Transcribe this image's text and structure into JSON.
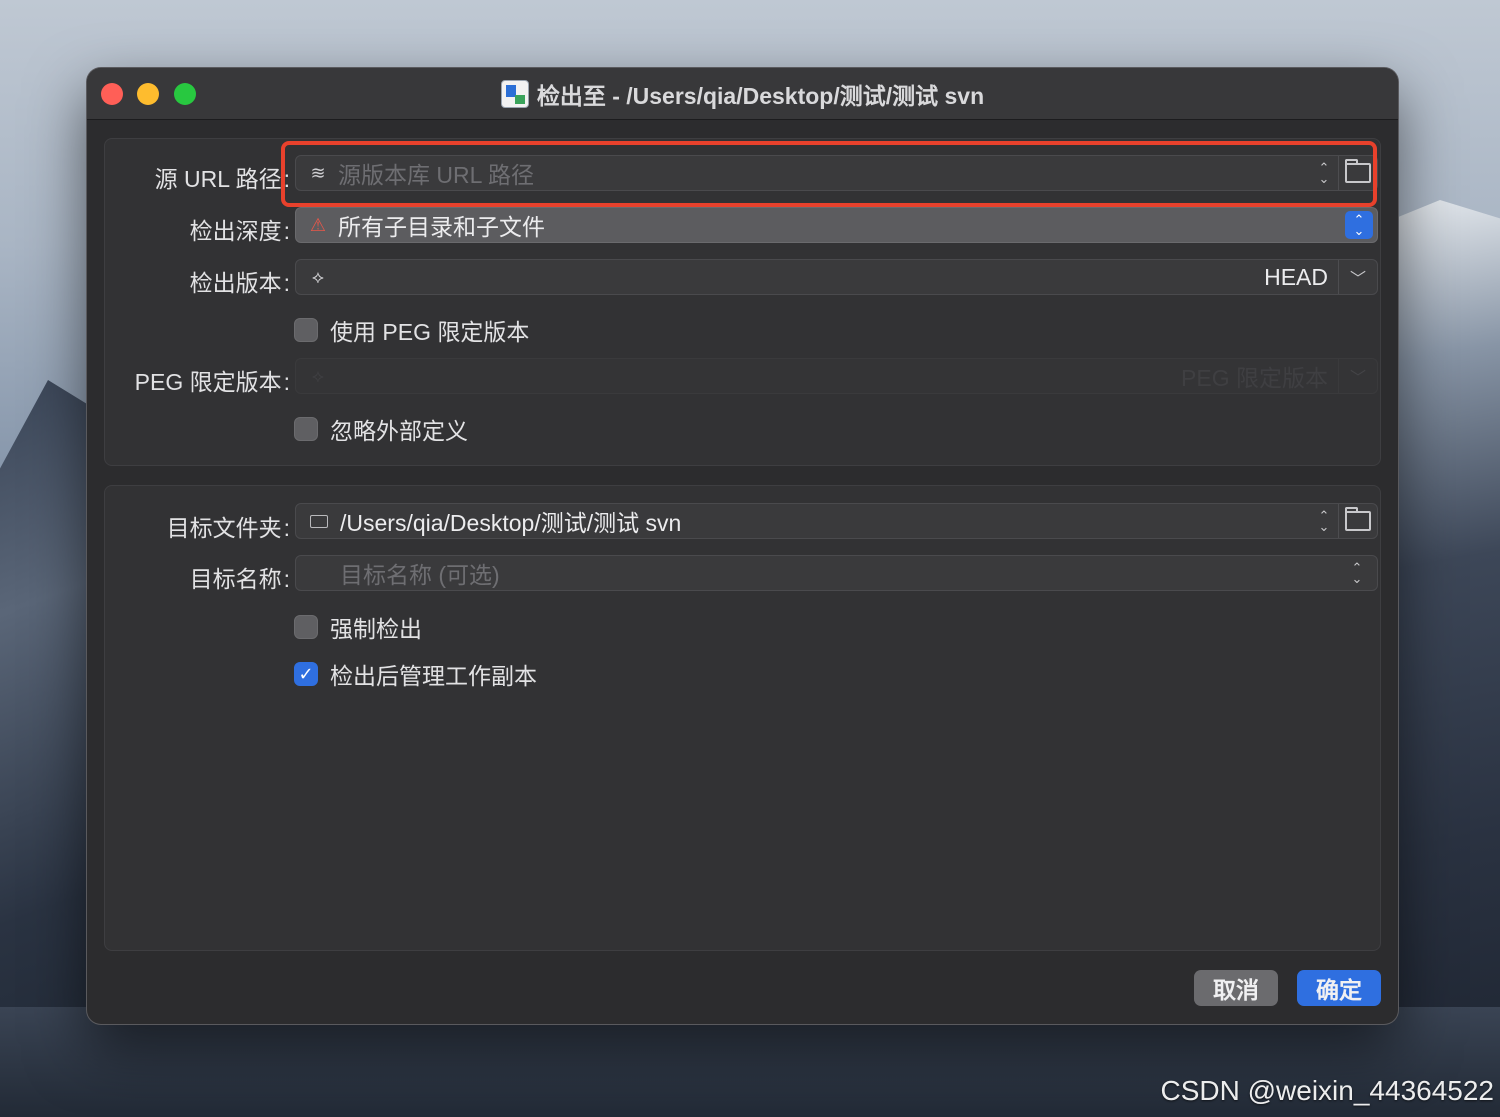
{
  "window": {
    "title": "检出至 - /Users/qia/Desktop/测试/测试 svn",
    "app_icon": "svn-app-icon"
  },
  "source": {
    "url_label": "源 URL 路径",
    "url_placeholder": "源版本库 URL 路径",
    "depth_label": "检出深度",
    "depth_value": "所有子目录和子文件",
    "revision_label": "检出版本",
    "revision_value": "HEAD",
    "use_peg_label": "使用 PEG 限定版本",
    "use_peg_checked": false,
    "peg_label": "PEG 限定版本",
    "peg_placeholder": "PEG 限定版本",
    "ignore_externals_label": "忽略外部定义",
    "ignore_externals_checked": false
  },
  "target": {
    "folder_label": "目标文件夹",
    "folder_value": "/Users/qia/Desktop/测试/测试 svn",
    "name_label": "目标名称",
    "name_placeholder": "目标名称 (可选)",
    "force_label": "强制检出",
    "force_checked": false,
    "manage_label": "检出后管理工作副本",
    "manage_checked": true
  },
  "buttons": {
    "cancel": "取消",
    "ok": "确定"
  },
  "colon": ":",
  "watermark": "CSDN @weixin_44364522",
  "colors": {
    "accent": "#2f6fe0",
    "highlight": "#e8412c",
    "window_bg": "#2c2c2e"
  }
}
